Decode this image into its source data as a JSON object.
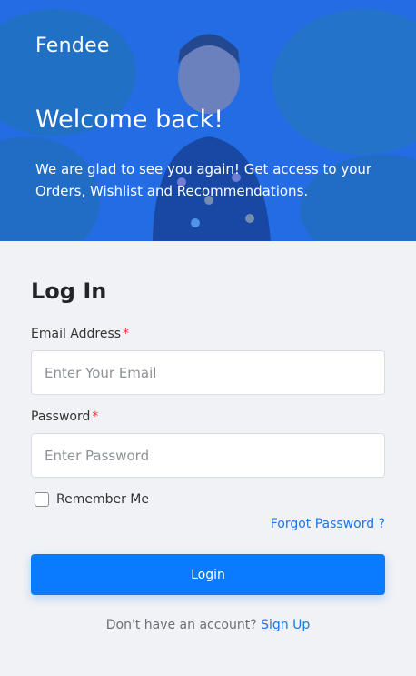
{
  "hero": {
    "brand": "Fendee",
    "title": "Welcome back!",
    "subtitle": "We are glad to see you again! Get access to your Orders, Wishlist and Recommendations."
  },
  "form": {
    "title": "Log In",
    "email_label": "Email Address",
    "email_placeholder": "Enter Your Email",
    "password_label": "Password",
    "password_placeholder": "Enter Password",
    "required_mark": "*",
    "remember_label": "Remember Me",
    "forgot_label": "Forgot Password ?",
    "login_label": "Login",
    "signup_prompt": "Don't have an account?",
    "signup_label": "Sign Up"
  },
  "colors": {
    "accent": "#0a7bff",
    "hero_overlay": "#1060e6",
    "required": "#e53935",
    "background": "#f0f2f5"
  }
}
